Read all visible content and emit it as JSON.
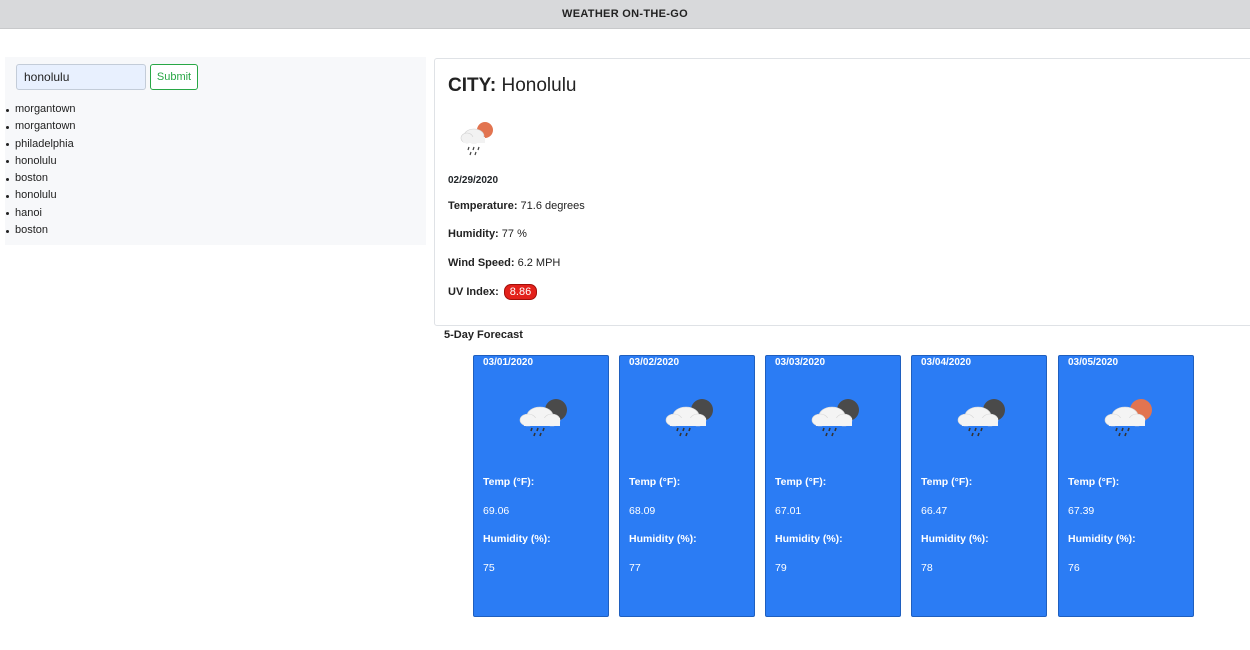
{
  "app": {
    "title": "WEATHER ON-THE-GO"
  },
  "search": {
    "value": "honolulu",
    "submit_label": "Submit"
  },
  "history": [
    "morgantown",
    "morgantown",
    "philadelphia",
    "honolulu",
    "boston",
    "honolulu",
    "hanoi",
    "boston"
  ],
  "current": {
    "city_label": "CITY:",
    "city": "Honolulu",
    "icon": "rain-partly-sunny-icon",
    "date": "02/29/2020",
    "temperature_label": "Temperature:",
    "temperature": "71.6 degrees",
    "humidity_label": "Humidity:",
    "humidity": "77 %",
    "wind_label": "Wind Speed:",
    "wind": "6.2 MPH",
    "uv_label": "UV Index:",
    "uv": "8.86",
    "uv_color": "#e3211b"
  },
  "forecast": {
    "heading": "5-Day Forecast",
    "card_color": "#2b7cf4",
    "temp_label": "Temp (°F):",
    "humidity_label": "Humidity (%):",
    "days": [
      {
        "date": "03/01/2020",
        "icon": "rain-night-icon",
        "temp": "69.06",
        "humidity": "75"
      },
      {
        "date": "03/02/2020",
        "icon": "rain-night-icon",
        "temp": "68.09",
        "humidity": "77"
      },
      {
        "date": "03/03/2020",
        "icon": "rain-night-icon",
        "temp": "67.01",
        "humidity": "79"
      },
      {
        "date": "03/04/2020",
        "icon": "rain-night-icon",
        "temp": "66.47",
        "humidity": "78"
      },
      {
        "date": "03/05/2020",
        "icon": "rain-partly-sunny-icon",
        "temp": "67.39",
        "humidity": "76"
      }
    ]
  }
}
